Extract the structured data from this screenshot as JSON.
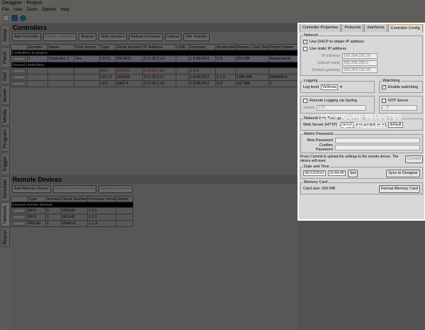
{
  "window": {
    "title": "Designer - Project"
  },
  "menu": [
    "File",
    "View",
    "Zoom",
    "Options",
    "Help"
  ],
  "toolbar": [
    "new-icon",
    "open-icon",
    "save-icon"
  ],
  "side_tabs": [
    {
      "label": "Setup"
    },
    {
      "label": "Patch"
    },
    {
      "label": "Dali"
    },
    {
      "label": "Mover"
    },
    {
      "label": "Media"
    },
    {
      "label": "Program"
    },
    {
      "label": "Trigger"
    },
    {
      "label": "Simulate"
    },
    {
      "label": "Network",
      "active": true
    },
    {
      "label": "Report"
    }
  ],
  "controllers": {
    "title": "Controllers",
    "buttons": [
      "Add Controller",
      "Delete Controller",
      "Beacon",
      "Web interface",
      "Reload Firmware",
      "Upload",
      "File Transfer"
    ],
    "columns": [
      "",
      "Number",
      "Name",
      "Time Server",
      "Type",
      "Serial Number",
      "IP Address",
      "USB",
      "Firmware",
      "Bootloader",
      "Memory Card Size",
      "Project Name"
    ],
    "group_in_project": "Controllers in project",
    "in_project": [
      [
        "",
        "1",
        "Controller 1",
        "Yes",
        "LPC1",
        "BETA03",
        "172.20.2.14",
        "",
        "1.8 BETA 2",
        "0.5",
        "250 MB",
        "Advanced A"
      ]
    ],
    "group_unused": "Unused controllers",
    "unused": [
      [
        "",
        "",
        "",
        "",
        "AVC",
        "031051",
        "172.20.2.12",
        "",
        "1.6.8",
        "",
        "",
        ""
      ],
      [
        "",
        "",
        "",
        "",
        "LPC X",
        "002006",
        "172.20.2.17",
        "",
        "1.8 BETA 2",
        "1.1.0",
        "1980 MB",
        "DMMMV3"
      ],
      [
        "",
        "",
        "",
        "",
        "LPC",
        "R&D 4",
        "172.20.2.15",
        "",
        "1.8 BETA 2",
        "0.0",
        "247 MB",
        "1"
      ]
    ]
  },
  "remote": {
    "title": "Remote Devices",
    "buttons": [
      "Add Remote Device",
      "Delete Remote Device",
      "Reload Firmware"
    ],
    "columns": [
      "",
      "Type",
      "Number",
      "Serial Number",
      "Firmware Version",
      "Joined"
    ],
    "group_unused": "Unused remote devices",
    "rows": [
      [
        "",
        "BPS",
        "5",
        "001026",
        "1.0.1",
        ""
      ],
      [
        "",
        "BPS",
        "1",
        "001041",
        "1.0.1",
        ""
      ],
      [
        "",
        "RIO 80",
        "1",
        "004013",
        "1.1.3",
        ""
      ]
    ]
  },
  "right": {
    "tabs": [
      "Controller Properties",
      "Protocols",
      "Interfaces",
      "Controller Config"
    ],
    "network": {
      "legend": "Network",
      "dhcp": "Use DHCP to obtain IP address",
      "static": "Use static IP address",
      "ip_label": "IP address",
      "ip": "169.254.192.25",
      "mask_label": "Subnet mask",
      "mask": "255.255.255.0",
      "gw_label": "Default gateway",
      "gw": "169.254.192.25"
    },
    "logging": {
      "legend": "Logging",
      "level_label": "Log level",
      "level": "Verbose"
    },
    "watchdog": {
      "legend": "Watchdog",
      "enable": "Enable watchdog"
    },
    "syslog": {
      "label": "Remote Logging via Syslog",
      "server_label": "Server",
      "server": "172..."
    },
    "ntp": {
      "label": "NTP Server",
      "server": "...0"
    },
    "ports": {
      "legend": "Network Port Settings",
      "web_label": "Web Server (HTTP)",
      "web": "default",
      "file_label": "File Server (FTP)",
      "file": "default"
    },
    "admin": {
      "legend": "Admin Password",
      "new_label": "New Password",
      "confirm_label": "Confirm Password"
    },
    "commit_note": "Press Commit to upload the settings to the remote device. The device will reset.",
    "commit": "Commit",
    "datetime": {
      "legend": "Date and Time",
      "date": "06/12/2010",
      "time": "16:44:40",
      "set": "Set",
      "sync": "Sync to Designer"
    },
    "memcard": {
      "legend": "Memory Card",
      "size": "Card size: 250 MB",
      "format": "Format Memory Card"
    }
  },
  "callout": {
    "line1": "CONFIGURE SELECTED",
    "line2": "CONTROLLER"
  }
}
